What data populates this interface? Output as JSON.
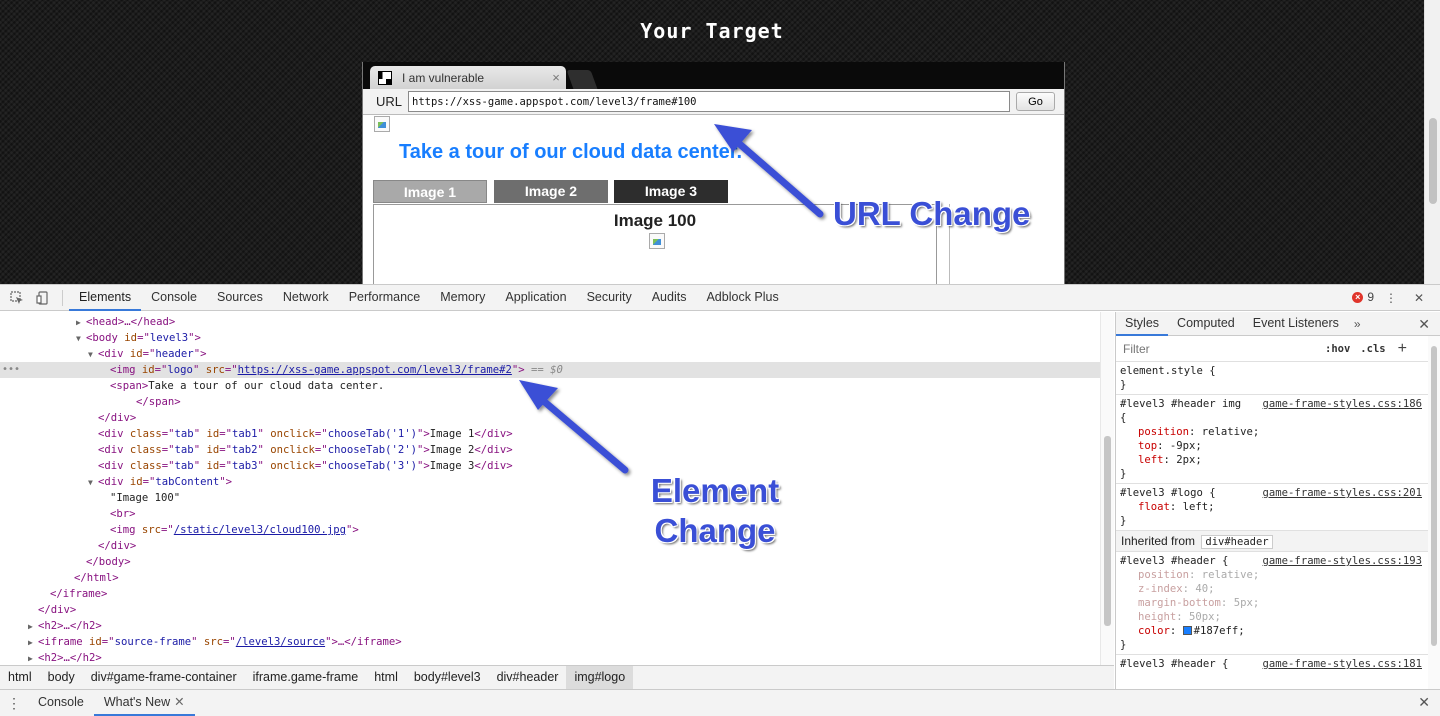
{
  "page": {
    "title": "Your Target"
  },
  "browser": {
    "tab_title": "I am vulnerable",
    "tab_close": "×",
    "url_label": "URL",
    "url_value": "https://xss-game.appspot.com/level3/frame#100",
    "go_label": "Go"
  },
  "frame": {
    "header_text": "Take a tour of our cloud data center.",
    "tabs": [
      "Image 1",
      "Image 2",
      "Image 3"
    ],
    "content_label": "Image 100"
  },
  "annotations": {
    "url_change": "URL Change",
    "element_change_line1": "Element",
    "element_change_line2": "Change",
    "color": "#3a4fd6"
  },
  "devtools": {
    "tabs": [
      "Elements",
      "Console",
      "Sources",
      "Network",
      "Performance",
      "Memory",
      "Application",
      "Security",
      "Audits",
      "Adblock Plus"
    ],
    "active_tab": "Elements",
    "error_count": "9",
    "dom": {
      "head": "<head>…</head>",
      "body_open_tag": "body",
      "body_id": "level3",
      "header_div_id": "header",
      "img_id": "logo",
      "img_src": "https://xss-game.appspot.com/level3/frame#2",
      "selected_suffix": " == $0",
      "span_text": "Take a tour of our cloud data center.",
      "tab_divs": [
        {
          "id": "tab1",
          "onclick": "chooseTab('1')",
          "text": "Image 1"
        },
        {
          "id": "tab2",
          "onclick": "chooseTab('2')",
          "text": "Image 2"
        },
        {
          "id": "tab3",
          "onclick": "chooseTab('3')",
          "text": "Image 3"
        }
      ],
      "tab_content_id": "tabContent",
      "tab_content_text": "\"Image 100\"",
      "cloud_src": "/static/level3/cloud100.jpg",
      "source_frame_id": "source-frame",
      "source_frame_src": "/level3/source"
    },
    "breadcrumbs": [
      "html",
      "body",
      "div#game-frame-container",
      "iframe.game-frame",
      "html",
      "body#level3",
      "div#header",
      "img#logo"
    ],
    "drawer_tabs": [
      "Console",
      "What's New"
    ],
    "drawer_active": "What's New"
  },
  "styles": {
    "tabs": [
      "Styles",
      "Computed",
      "Event Listeners"
    ],
    "more": "»",
    "filter_placeholder": "Filter",
    "hov": ":hov",
    "cls": ".cls",
    "element_style": "element.style {",
    "rules": [
      {
        "selector": "#level3 #header img",
        "source": "game-frame-styles.css:186",
        "decls": [
          {
            "prop": "position",
            "value": "relative;"
          },
          {
            "prop": "top",
            "value": "-9px;"
          },
          {
            "prop": "left",
            "value": "2px;"
          }
        ]
      },
      {
        "selector": "#level3 #logo {",
        "source": "game-frame-styles.css:201",
        "decls": [
          {
            "prop": "float",
            "value": "left;"
          }
        ]
      }
    ],
    "inherited_label": "Inherited from",
    "inherited_from": "div#header",
    "inherited_rule": {
      "selector": "#level3 #header {",
      "source": "game-frame-styles.css:193",
      "decls": [
        {
          "prop": "position",
          "value": "relative;"
        },
        {
          "prop": "z-index",
          "value": "40;"
        },
        {
          "prop": "margin-bottom",
          "value": "5px;"
        },
        {
          "prop": "height",
          "value": "50px;"
        },
        {
          "prop": "color",
          "value": "#187eff;"
        }
      ]
    },
    "last_rule": {
      "selector": "#level3 #header {",
      "source": "game-frame-styles.css:181"
    }
  }
}
